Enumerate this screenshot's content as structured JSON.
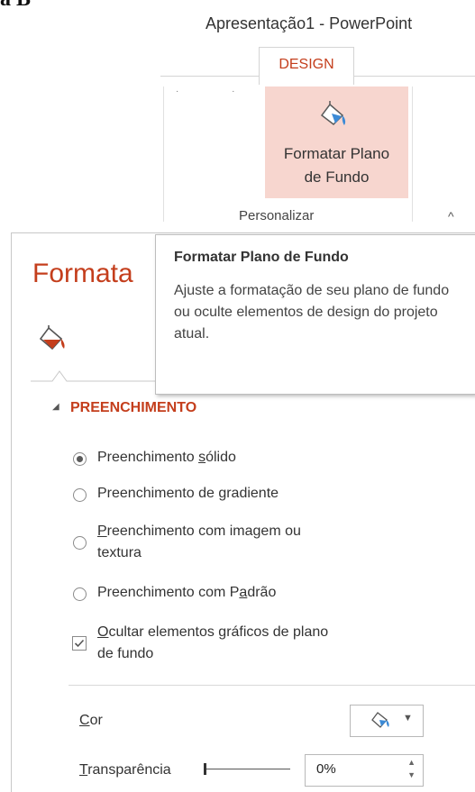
{
  "corner_letter": "a B",
  "window": {
    "title": "Apresentação1 - PowerPoint"
  },
  "ribbon": {
    "active_tab": "DESIGN",
    "button": {
      "line1": "Formatar Plano",
      "line2": "de Fundo",
      "icon": "format-background-icon"
    },
    "group_label": "Personalizar",
    "collapse_icon": "^"
  },
  "pane": {
    "title": "Formata",
    "section": "PREENCHIMENTO",
    "fill_options": [
      {
        "before": "Preenchimento ",
        "key": "s",
        "after": "ólido",
        "selected": true
      },
      {
        "before": "Preenchimento de ",
        "key": "g",
        "after": "radiente",
        "selected": false
      },
      {
        "before": "",
        "key": "P",
        "after": "reenchimento com imagem ou",
        "line2": "textura",
        "selected": false
      },
      {
        "before": "Preenchimento  com P",
        "key": "a",
        "after": "drão",
        "selected": false
      }
    ],
    "hide_graphics": {
      "key": "O",
      "after": "cultar elementos gráficos de plano",
      "line2": "de fundo",
      "checked": true
    },
    "color": {
      "key": "C",
      "after": "or"
    },
    "transparency": {
      "key": "T",
      "after": "ransparência",
      "value": "0%",
      "level": 0
    }
  },
  "tooltip": {
    "title": "Formatar Plano de Fundo",
    "body": "Ajuste a formatação de seu plano de fundo ou oculte elementos de design do projeto atual."
  },
  "colors": {
    "accent": "#c43e1c",
    "hover": "#f7d6cf"
  }
}
